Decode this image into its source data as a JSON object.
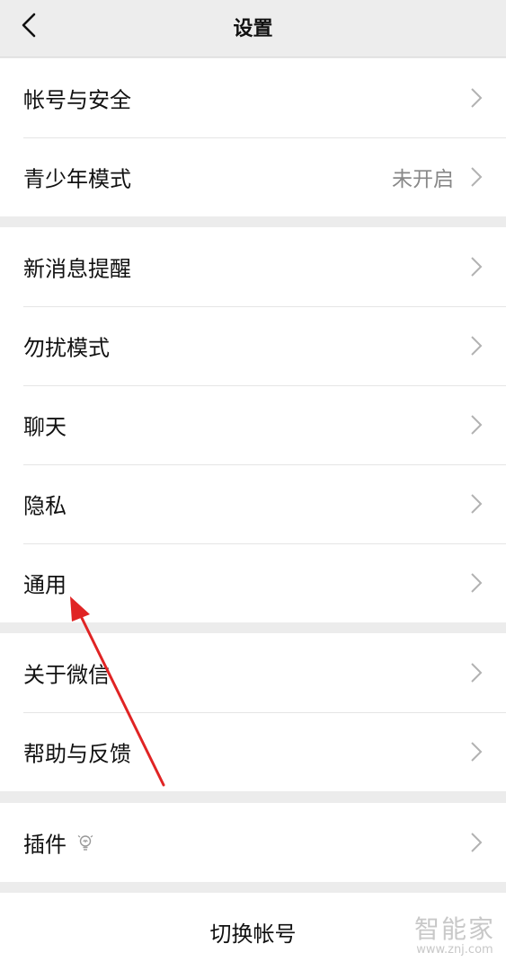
{
  "header": {
    "title": "设置",
    "back_icon": "chevron-left-icon"
  },
  "groups": [
    {
      "items": [
        {
          "label": "帐号与安全",
          "value": ""
        },
        {
          "label": "青少年模式",
          "value": "未开启"
        }
      ]
    },
    {
      "items": [
        {
          "label": "新消息提醒",
          "value": ""
        },
        {
          "label": "勿扰模式",
          "value": ""
        },
        {
          "label": "聊天",
          "value": ""
        },
        {
          "label": "隐私",
          "value": ""
        },
        {
          "label": "通用",
          "value": ""
        }
      ]
    },
    {
      "items": [
        {
          "label": "关于微信",
          "value": ""
        },
        {
          "label": "帮助与反馈",
          "value": ""
        }
      ]
    },
    {
      "items": [
        {
          "label": "插件",
          "value": "",
          "icon": "lightbulb-icon"
        }
      ]
    }
  ],
  "switch_account": {
    "label": "切换帐号"
  },
  "watermark": {
    "text": "智能家",
    "url": "www.znj.com"
  },
  "annotation": {
    "arrow_color": "#e02424",
    "points_to": "通用"
  },
  "colors": {
    "background": "#ececec",
    "row_bg": "#ffffff",
    "text": "#111111",
    "secondary": "#888888"
  }
}
